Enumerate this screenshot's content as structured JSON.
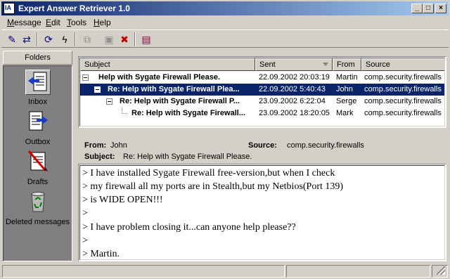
{
  "window": {
    "title": "Expert Answer Retriever 1.0",
    "minimize": "_",
    "maximize": "□",
    "close": "×"
  },
  "menu": [
    "Message",
    "Edit",
    "Tools",
    "Help"
  ],
  "toolbar": [
    {
      "icon": "new-message-icon",
      "glyph": "✎",
      "color": "#000080"
    },
    {
      "icon": "forward-message-icon",
      "glyph": "⇄",
      "color": "#000080"
    },
    {
      "icon": "retrieve-icon",
      "glyph": "⟳",
      "color": "#000080"
    },
    {
      "icon": "lightning-icon",
      "glyph": "ϟ",
      "color": "#000000"
    },
    {
      "icon": "copy-icon",
      "glyph": "⧉",
      "color": "#909090"
    },
    {
      "icon": "properties-icon",
      "glyph": "▣",
      "color": "#909090"
    },
    {
      "icon": "delete-icon",
      "glyph": "✖",
      "color": "#c00000"
    },
    {
      "icon": "address-book-icon",
      "glyph": "▤",
      "color": "#800040"
    }
  ],
  "folders": {
    "header": "Folders",
    "items": [
      {
        "label": "Inbox",
        "icon": "inbox-icon",
        "selected": true
      },
      {
        "label": "Outbox",
        "icon": "outbox-icon",
        "selected": false
      },
      {
        "label": "Drafts",
        "icon": "drafts-icon",
        "selected": false
      },
      {
        "label": "Deleted messages",
        "icon": "recycle-bin-icon",
        "selected": false
      }
    ]
  },
  "list": {
    "columns": [
      "Subject",
      "Sent",
      "From",
      "Source"
    ],
    "rows": [
      {
        "subject": "Help with Sygate Firewall Please.",
        "sent": "22.09.2002 20:03:19",
        "from": "Martin",
        "source": "comp.security.firewalls",
        "selected": false
      },
      {
        "subject": "Re: Help with Sygate Firewall Plea...",
        "sent": "22.09.2002 5:40:43",
        "from": "John",
        "source": "comp.security.firewalls",
        "selected": true
      },
      {
        "subject": "Re: Help with Sygate Firewall P...",
        "sent": "23.09.2002 6:22:04",
        "from": "Serge",
        "source": "comp.security.firewalls",
        "selected": false
      },
      {
        "subject": "Re: Help with Sygate Firewall...",
        "sent": "23.09.2002 18:20:05",
        "from": "Mark",
        "source": "comp.security.firewalls",
        "selected": false
      }
    ]
  },
  "message": {
    "from_label": "From:",
    "from": "John",
    "source_label": "Source:",
    "source": "comp.security.firewalls",
    "subject_label": "Subject:",
    "subject": "Re: Help with Sygate Firewall Please.",
    "body": [
      "> I have installed Sygate Firewall free-version,but when I check",
      "> my firewall all my ports are in Stealth,but my Netbios(Port 139)",
      "> is WIDE OPEN!!!",
      ">",
      "> I have problem closing it...can anyone help please??",
      ">",
      "> Martin."
    ]
  },
  "status": [
    "",
    "",
    ""
  ]
}
